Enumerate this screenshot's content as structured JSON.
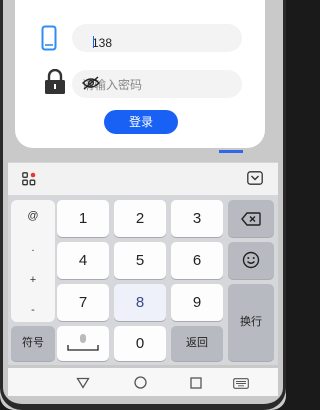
{
  "login": {
    "phone_value": "138",
    "password_placeholder": "请输入密码",
    "login_button": "登录"
  },
  "keyboard": {
    "side_keys": [
      "@",
      ".",
      "+",
      "-"
    ],
    "digits": [
      "1",
      "2",
      "3",
      "4",
      "5",
      "6",
      "7",
      "8",
      "9",
      "0"
    ],
    "symbols_label": "符号",
    "return_label": "返回",
    "newline_label": "换行"
  },
  "colors": {
    "accent": "#1960f5",
    "phone_icon": "#2f8cf0"
  }
}
